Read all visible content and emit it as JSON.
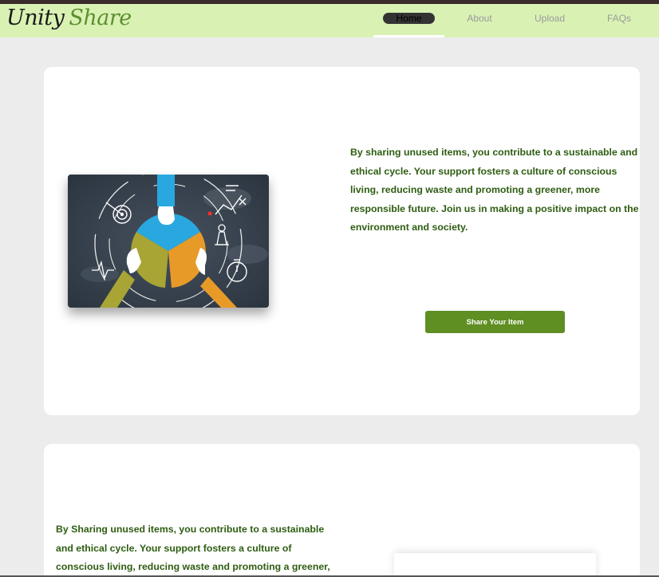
{
  "brand": {
    "word1": "Unity",
    "word2": "Share"
  },
  "nav": {
    "home": "Home",
    "about": "About",
    "upload": "Upload",
    "faqs": "FAQs"
  },
  "colors": {
    "navbar_bg": "#d9f2b4",
    "accent_green": "#5f8e22",
    "text_green": "#2e5d11",
    "page_bg": "#ececec"
  },
  "hero": {
    "description": "By sharing unused items, you contribute to a sustainable and ethical cycle. Your support fosters a culture of conscious living, reducing waste and promoting a greener, more responsible future. Join us in making a positive impact on the environment and society.",
    "button_label": "Share Your Item"
  },
  "section2": {
    "description": "By Sharing unused items, you contribute to a sustainable and ethical cycle. Your support fosters a culture of conscious living, reducing waste and promoting a greener, more"
  }
}
